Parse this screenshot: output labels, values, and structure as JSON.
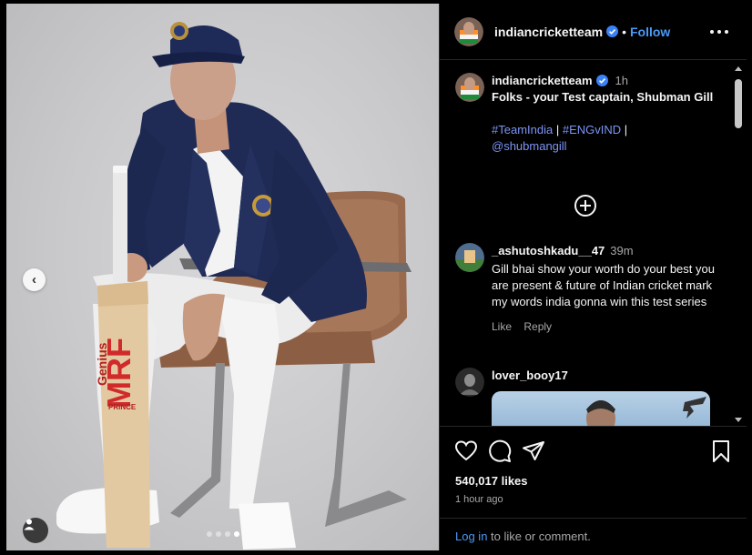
{
  "post": {
    "username": "indiancricketteam",
    "follow_label": "Follow",
    "separator": "•",
    "caption": {
      "username": "indiancricketteam",
      "time": "1h",
      "text": "Folks - your Test captain, Shubman Gill",
      "tags": [
        "#TeamIndia",
        "#ENGvIND",
        "@shubmangill"
      ],
      "pipe": "|"
    },
    "carousel": {
      "total": 4,
      "active_index": 3
    },
    "photo_print": {
      "bat_brand": "MRF",
      "bat_sub": "Genius",
      "bat_model": "PRINCE"
    }
  },
  "comments": [
    {
      "username": "_ashutoshkadu__47",
      "time": "39m",
      "text": "Gill bhai show your worth do your best you are present & future of Indian cricket mark my words india gonna win this test series",
      "like_label": "Like",
      "reply_label": "Reply"
    },
    {
      "username": "lover_booy17"
    }
  ],
  "footer": {
    "likes": "540,017 likes",
    "time_ago": "1 hour ago",
    "login_link": "Log in",
    "login_suffix": " to like or comment."
  },
  "icons": [
    "heart-icon",
    "comment-icon",
    "share-icon",
    "bookmark-icon",
    "more-icon",
    "plus-circle-icon",
    "user-tag-icon",
    "chevron-left-icon",
    "verified-icon"
  ],
  "colors": {
    "accent": "#4a9af7",
    "hashtag": "#7c95f5",
    "background": "#000000",
    "muted": "#a8a8a8"
  }
}
